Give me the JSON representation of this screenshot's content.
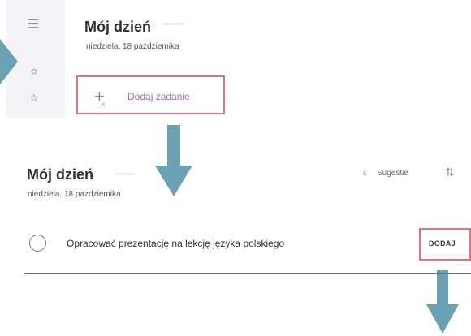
{
  "top_panel": {
    "title": "Mój dzień",
    "date": "niedziela, 18 pazdziemika",
    "add_task_label": "Dodaj zadanie",
    "sidebar_icons": [
      "menu-icon",
      "sun-icon",
      "star-icon"
    ]
  },
  "bottom_panel": {
    "title": "Mój dzień",
    "date": "niedziela, 18 pazdziemika",
    "suggestions_label": "Sugestie",
    "task_input_value": "Opracować prezentację na lekcję języka polskiego",
    "add_button_label": "DODAJ"
  },
  "colors": {
    "arrow": "#6aa1b3",
    "highlight_border": "#e57383",
    "accent_text": "#9b6fb8"
  }
}
